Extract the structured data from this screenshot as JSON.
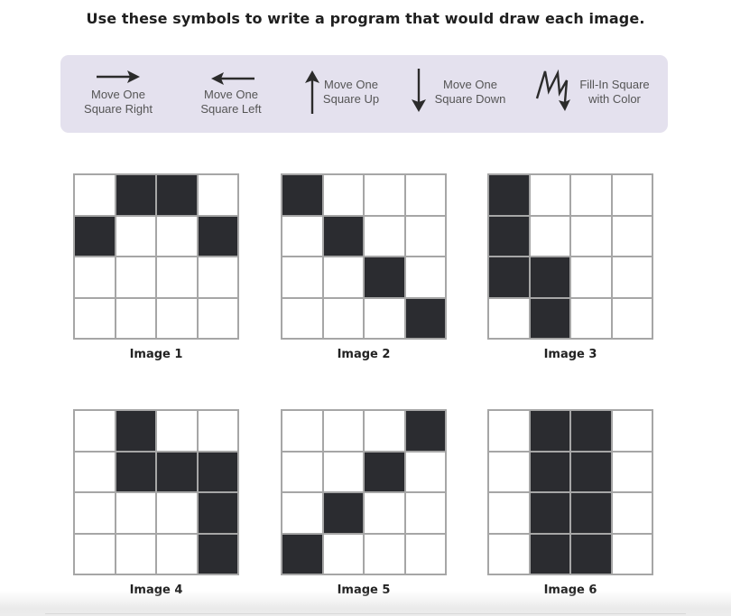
{
  "instruction": "Use these symbols to write a program that would draw each image.",
  "legend": [
    {
      "icon": "arrow-right-icon",
      "label": "Move One\nSquare Right"
    },
    {
      "icon": "arrow-left-icon",
      "label": "Move One\nSquare Left"
    },
    {
      "icon": "arrow-up-icon",
      "label": "Move One\nSquare Up"
    },
    {
      "icon": "arrow-down-icon",
      "label": "Move One\nSquare Down"
    },
    {
      "icon": "fill-zigzag-icon",
      "label": "Fill-In Square\nwith Color"
    }
  ],
  "colors": {
    "filled": "#2b2c30",
    "grid_line": "#a6a6a6",
    "legend_bg": "#e4e1ee"
  },
  "images": [
    {
      "label": "Image 1",
      "cells": [
        [
          0,
          1,
          1,
          0
        ],
        [
          1,
          0,
          0,
          1
        ],
        [
          0,
          0,
          0,
          0
        ],
        [
          0,
          0,
          0,
          0
        ]
      ]
    },
    {
      "label": "Image 2",
      "cells": [
        [
          1,
          0,
          0,
          0
        ],
        [
          0,
          1,
          0,
          0
        ],
        [
          0,
          0,
          1,
          0
        ],
        [
          0,
          0,
          0,
          1
        ]
      ]
    },
    {
      "label": "Image 3",
      "cells": [
        [
          1,
          0,
          0,
          0
        ],
        [
          1,
          0,
          0,
          0
        ],
        [
          1,
          1,
          0,
          0
        ],
        [
          0,
          1,
          0,
          0
        ]
      ]
    },
    {
      "label": "Image 4",
      "cells": [
        [
          0,
          1,
          0,
          0
        ],
        [
          0,
          1,
          1,
          1
        ],
        [
          0,
          0,
          0,
          1
        ],
        [
          0,
          0,
          0,
          1
        ]
      ]
    },
    {
      "label": "Image 5",
      "cells": [
        [
          0,
          0,
          0,
          1
        ],
        [
          0,
          0,
          1,
          0
        ],
        [
          0,
          1,
          0,
          0
        ],
        [
          1,
          0,
          0,
          0
        ]
      ]
    },
    {
      "label": "Image 6",
      "cells": [
        [
          0,
          1,
          1,
          0
        ],
        [
          0,
          1,
          1,
          0
        ],
        [
          0,
          1,
          1,
          0
        ],
        [
          0,
          1,
          1,
          0
        ]
      ]
    }
  ]
}
